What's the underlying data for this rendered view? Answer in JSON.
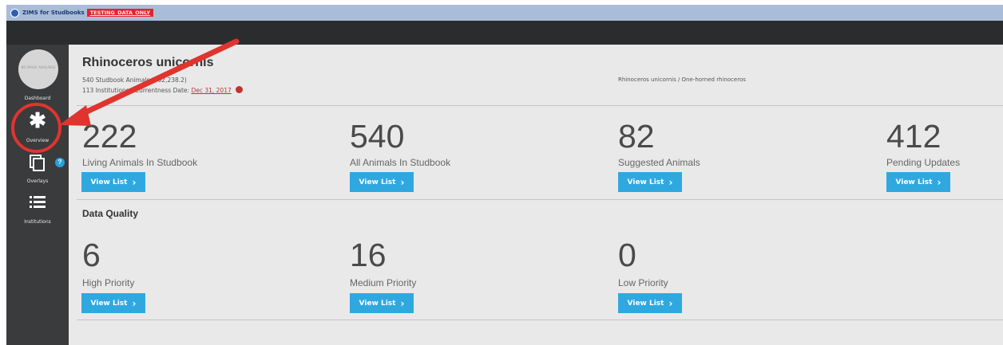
{
  "window": {
    "title": "ZIMS for Studbooks",
    "tag": "TESTING_DATA_ONLY"
  },
  "sidebar": {
    "avatar_text": "NO IMAGE AVAILABLE",
    "items": [
      {
        "label": "Dashboard",
        "icon": "dashboard-avatar"
      },
      {
        "label": "Overview",
        "icon": "asterisk-icon"
      },
      {
        "label": "Overlays",
        "icon": "overlay-stack-icon"
      },
      {
        "label": "Institutions",
        "icon": "list-icon"
      }
    ],
    "help_badge": "?"
  },
  "header": {
    "species": "Rhinoceros unicornis",
    "line1": "540 Studbook Animals (502,238.2)",
    "line2_prefix": "113 Institutions / Currentness Date:",
    "currentness_date": "Dec 31, 2017",
    "common_name": "Rhinoceros unicornis / One-horned rhinoceros"
  },
  "stats": [
    {
      "value": "222",
      "label": "Living Animals In Studbook",
      "button": "View List"
    },
    {
      "value": "540",
      "label": "All Animals In Studbook",
      "button": "View List"
    },
    {
      "value": "82",
      "label": "Suggested Animals",
      "button": "View List"
    },
    {
      "value": "412",
      "label": "Pending Updates",
      "button": "View List"
    }
  ],
  "data_quality": {
    "title": "Data Quality",
    "items": [
      {
        "value": "6",
        "label": "High Priority",
        "button": "View List"
      },
      {
        "value": "16",
        "label": "Medium Priority",
        "button": "View List"
      },
      {
        "value": "0",
        "label": "Low Priority",
        "button": "View List"
      }
    ]
  },
  "colors": {
    "accent_button": "#2fa8e0",
    "annotation": "#e0342e",
    "sidebar": "#3a3b3d",
    "date_red": "#c0332f"
  }
}
